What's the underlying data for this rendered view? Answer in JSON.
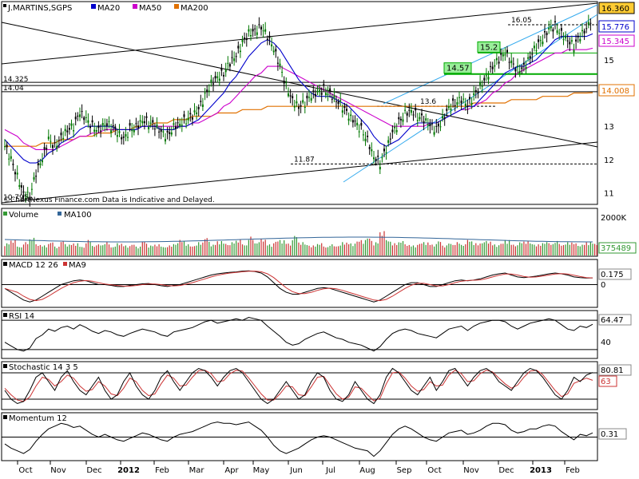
{
  "chart_data": {
    "type": "line",
    "symbol": "J.MARTINS,SGPS",
    "watermark": "©ChartNexus Finance.com   Data is Indicative and Delayed.",
    "x_labels": [
      "Oct",
      "Nov",
      "Dec",
      "2012",
      "Feb",
      "Mar",
      "Apr",
      "May",
      "Jun",
      "Jul",
      "Aug",
      "Sep",
      "Oct",
      "Nov",
      "Dec",
      "2013",
      "Feb"
    ],
    "price_panel": {
      "series_legend": [
        "MA20",
        "MA50",
        "MA200"
      ],
      "legend_colors": [
        "#0000cc",
        "#cc00cc",
        "#e07000"
      ],
      "y_ticks": [
        "16",
        "15",
        "14",
        "13",
        "12",
        "11"
      ],
      "ylim": [
        10.8,
        16.6
      ],
      "last_values": [
        {
          "label": "16.360",
          "value": 16.36,
          "color": "#000000",
          "bg": "#ffcc33"
        },
        {
          "label": "15.776",
          "value": 15.776,
          "color": "#0000cc",
          "bg": "#ffffff"
        },
        {
          "label": "15.345",
          "value": 15.345,
          "color": "#cc00cc",
          "bg": "#ffffff"
        },
        {
          "label": "14.008",
          "value": 14.008,
          "color": "#e07000",
          "bg": "#ffffff"
        }
      ],
      "level_annotations": [
        {
          "text": "16.05",
          "value": 16.05
        },
        {
          "text": "15.2",
          "value": 15.2,
          "box": true
        },
        {
          "text": "14.57",
          "value": 14.57,
          "box": true
        },
        {
          "text": "14.325",
          "value": 14.32
        },
        {
          "text": "14.04",
          "value": 14.04
        },
        {
          "text": "13.6",
          "value": 13.6
        },
        {
          "text": "11.87",
          "value": 11.87
        },
        {
          "text": "10.795",
          "value": 10.9
        }
      ],
      "price_series": [
        12.4,
        12.0,
        11.5,
        11.0,
        10.9,
        11.6,
        12.0,
        12.6,
        12.4,
        12.7,
        12.9,
        13.0,
        13.4,
        13.2,
        13.0,
        12.9,
        13.1,
        13.0,
        12.8,
        12.6,
        12.9,
        13.0,
        13.2,
        13.1,
        13.0,
        12.8,
        12.7,
        13.0,
        13.1,
        13.2,
        13.3,
        13.5,
        13.9,
        14.3,
        14.5,
        14.6,
        14.9,
        15.1,
        15.5,
        15.8,
        15.9,
        16.0,
        15.7,
        15.3,
        14.8,
        14.2,
        13.8,
        13.6,
        13.7,
        13.9,
        14.0,
        14.1,
        14.0,
        13.8,
        13.6,
        13.3,
        13.1,
        12.9,
        12.6,
        12.1,
        11.9,
        12.3,
        12.8,
        13.1,
        13.4,
        13.5,
        13.3,
        13.2,
        13.0,
        12.9,
        13.2,
        13.6,
        13.7,
        13.8,
        13.6,
        13.9,
        14.2,
        14.5,
        14.8,
        15.0,
        15.2,
        14.9,
        14.7,
        14.8,
        15.1,
        15.4,
        15.6,
        15.9,
        16.0,
        15.8,
        15.6,
        15.4,
        15.7,
        15.9,
        16.36
      ],
      "ma20_series": [
        12.6,
        12.4,
        12.2,
        12.0,
        11.9,
        11.9,
        12.0,
        12.2,
        12.3,
        12.5,
        12.6,
        12.7,
        12.9,
        13.0,
        13.0,
        13.0,
        13.0,
        13.0,
        12.9,
        12.9,
        12.9,
        12.9,
        13.0,
        13.0,
        13.0,
        12.9,
        12.9,
        12.9,
        13.0,
        13.0,
        13.1,
        13.2,
        13.4,
        13.6,
        13.8,
        14.0,
        14.3,
        14.5,
        14.8,
        15.1,
        15.3,
        15.5,
        15.6,
        15.5,
        15.3,
        15.0,
        14.7,
        14.4,
        14.2,
        14.0,
        13.9,
        13.9,
        13.9,
        13.8,
        13.7,
        13.6,
        13.4,
        13.2,
        13.0,
        12.7,
        12.5,
        12.4,
        12.5,
        12.6,
        12.8,
        13.0,
        13.1,
        13.1,
        13.1,
        13.1,
        13.2,
        13.3,
        13.4,
        13.5,
        13.6,
        13.6,
        13.8,
        14.0,
        14.2,
        14.4,
        14.6,
        14.7,
        14.8,
        14.8,
        14.9,
        15.0,
        15.2,
        15.4,
        15.6,
        15.7,
        15.7,
        15.7,
        15.7,
        15.7,
        15.776
      ],
      "ma50_series": [
        12.9,
        12.8,
        12.7,
        12.5,
        12.4,
        12.3,
        12.3,
        12.3,
        12.3,
        12.4,
        12.5,
        12.6,
        12.7,
        12.7,
        12.8,
        12.8,
        12.9,
        12.9,
        12.9,
        12.9,
        12.9,
        12.9,
        13.0,
        13.0,
        13.0,
        13.0,
        13.0,
        13.0,
        13.0,
        13.0,
        13.1,
        13.1,
        13.2,
        13.3,
        13.4,
        13.6,
        13.7,
        13.9,
        14.1,
        14.3,
        14.5,
        14.6,
        14.8,
        14.8,
        14.8,
        14.7,
        14.6,
        14.5,
        14.4,
        14.3,
        14.2,
        14.1,
        14.0,
        13.9,
        13.8,
        13.7,
        13.6,
        13.5,
        13.4,
        13.3,
        13.2,
        13.1,
        13.0,
        13.0,
        13.0,
        13.0,
        13.0,
        13.0,
        13.1,
        13.1,
        13.2,
        13.3,
        13.4,
        13.5,
        13.5,
        13.6,
        13.7,
        13.8,
        14.0,
        14.1,
        14.3,
        14.4,
        14.6,
        14.7,
        14.8,
        14.9,
        15.0,
        15.1,
        15.2,
        15.2,
        15.3,
        15.3,
        15.3,
        15.3,
        15.345
      ],
      "ma200_series": [
        12.4,
        12.4,
        12.4,
        12.4,
        12.4,
        12.4,
        12.5,
        12.5,
        12.5,
        12.6,
        12.6,
        12.6,
        12.7,
        12.7,
        12.7,
        12.8,
        12.8,
        12.8,
        12.9,
        12.9,
        12.9,
        13.0,
        13.0,
        13.0,
        13.1,
        13.1,
        13.1,
        13.2,
        13.2,
        13.2,
        13.3,
        13.3,
        13.3,
        13.3,
        13.4,
        13.4,
        13.4,
        13.4,
        13.5,
        13.5,
        13.5,
        13.5,
        13.6,
        13.6,
        13.6,
        13.6,
        13.6,
        13.6,
        13.6,
        13.6,
        13.6,
        13.6,
        13.6,
        13.6,
        13.6,
        13.6,
        13.6,
        13.6,
        13.6,
        13.6,
        13.6,
        13.6,
        13.6,
        13.6,
        13.6,
        13.6,
        13.6,
        13.6,
        13.6,
        13.6,
        13.6,
        13.6,
        13.6,
        13.6,
        13.6,
        13.7,
        13.7,
        13.7,
        13.7,
        13.7,
        13.7,
        13.8,
        13.8,
        13.8,
        13.8,
        13.8,
        13.9,
        13.9,
        13.9,
        13.9,
        13.9,
        14.0,
        14.0,
        14.0,
        14.008
      ]
    },
    "volume_panel": {
      "series_legend": [
        "Volume",
        "MA100"
      ],
      "legend_colors": [
        "#339933",
        "#336699"
      ],
      "y_ticks": [
        "2000K"
      ],
      "last_value": "375489",
      "values": [
        0.45,
        0.6,
        0.3,
        0.5,
        0.7,
        0.4,
        0.35,
        0.5,
        0.3,
        0.55,
        0.4,
        0.45,
        0.3,
        0.6,
        0.35,
        0.4,
        0.5,
        0.3,
        0.45,
        0.35,
        0.4,
        0.3,
        0.55,
        0.35,
        0.4,
        0.3,
        0.35,
        0.45,
        0.6,
        0.4,
        0.35,
        0.5,
        0.7,
        0.4,
        0.55,
        0.45,
        0.5,
        0.6,
        0.4,
        0.75,
        0.5,
        0.65,
        0.4,
        0.55,
        0.6,
        0.45,
        0.8,
        0.5,
        0.4,
        0.35,
        0.45,
        0.3,
        0.4,
        0.35,
        0.5,
        0.45,
        0.55,
        0.6,
        0.7,
        0.5,
        1.0,
        0.6,
        0.45,
        0.55,
        0.4,
        0.35,
        0.45,
        0.5,
        0.4,
        0.55,
        0.35,
        0.45,
        0.5,
        0.4,
        0.6,
        0.45,
        0.5,
        0.55,
        0.4,
        0.45,
        0.6,
        0.4,
        0.5,
        0.55,
        0.45,
        0.4,
        0.5,
        0.45,
        0.55,
        0.4,
        0.5,
        0.45,
        0.4,
        0.5,
        0.45
      ]
    },
    "macd_panel": {
      "series_legend": [
        "MACD 12 26",
        "MA9"
      ],
      "legend_colors": [
        "#000000",
        "#cc3333"
      ],
      "y_ticks": [
        "0"
      ],
      "last_value": "0.175",
      "values": [
        -0.1,
        -0.2,
        -0.3,
        -0.4,
        -0.45,
        -0.4,
        -0.3,
        -0.2,
        -0.1,
        0.0,
        0.05,
        0.1,
        0.12,
        0.1,
        0.05,
        0.0,
        0.0,
        -0.02,
        -0.05,
        -0.05,
        -0.02,
        0.0,
        0.02,
        0.03,
        0.0,
        -0.03,
        -0.05,
        -0.02,
        0.0,
        0.05,
        0.1,
        0.15,
        0.2,
        0.25,
        0.28,
        0.3,
        0.32,
        0.33,
        0.35,
        0.36,
        0.34,
        0.3,
        0.2,
        0.05,
        -0.1,
        -0.2,
        -0.25,
        -0.25,
        -0.2,
        -0.15,
        -0.1,
        -0.08,
        -0.1,
        -0.15,
        -0.2,
        -0.25,
        -0.3,
        -0.35,
        -0.4,
        -0.45,
        -0.4,
        -0.3,
        -0.2,
        -0.1,
        0.0,
        0.05,
        0.05,
        0.0,
        -0.05,
        -0.05,
        0.0,
        0.05,
        0.1,
        0.12,
        0.1,
        0.12,
        0.15,
        0.2,
        0.25,
        0.28,
        0.3,
        0.25,
        0.2,
        0.18,
        0.2,
        0.22,
        0.25,
        0.28,
        0.3,
        0.28,
        0.25,
        0.2,
        0.18,
        0.17,
        0.175
      ],
      "ylim": [
        -0.55,
        0.55
      ]
    },
    "rsi_panel": {
      "series_legend": [
        "RSI 14"
      ],
      "y_ticks": [
        "40"
      ],
      "last_value": "64.47",
      "values": [
        40,
        35,
        30,
        28,
        32,
        45,
        50,
        58,
        55,
        60,
        62,
        58,
        64,
        60,
        55,
        52,
        56,
        54,
        50,
        48,
        52,
        55,
        58,
        56,
        54,
        50,
        48,
        54,
        56,
        58,
        60,
        64,
        68,
        70,
        66,
        68,
        70,
        72,
        70,
        74,
        72,
        70,
        62,
        55,
        48,
        40,
        36,
        38,
        44,
        48,
        52,
        54,
        50,
        46,
        44,
        40,
        38,
        36,
        32,
        28,
        34,
        44,
        52,
        56,
        58,
        56,
        52,
        50,
        48,
        46,
        52,
        58,
        60,
        62,
        56,
        62,
        66,
        68,
        70,
        70,
        68,
        62,
        58,
        62,
        66,
        68,
        70,
        72,
        70,
        64,
        58,
        56,
        62,
        60,
        64.47
      ],
      "ylim": [
        20,
        80
      ]
    },
    "stoch_panel": {
      "series_legend": [
        "Stochastic 14 3 5"
      ],
      "y_ticks": [
        "63"
      ],
      "last_values": [
        "80.81",
        "63"
      ],
      "values": [
        40,
        20,
        10,
        15,
        40,
        70,
        80,
        60,
        40,
        70,
        85,
        60,
        40,
        30,
        50,
        70,
        40,
        20,
        30,
        60,
        80,
        50,
        30,
        20,
        40,
        70,
        85,
        60,
        40,
        60,
        80,
        90,
        85,
        70,
        50,
        70,
        85,
        90,
        80,
        60,
        40,
        20,
        10,
        20,
        40,
        60,
        40,
        20,
        30,
        60,
        80,
        70,
        40,
        20,
        15,
        30,
        60,
        40,
        20,
        10,
        30,
        70,
        90,
        80,
        60,
        40,
        30,
        50,
        70,
        40,
        60,
        85,
        90,
        70,
        50,
        70,
        85,
        90,
        80,
        60,
        50,
        40,
        60,
        80,
        90,
        85,
        70,
        50,
        30,
        20,
        40,
        70,
        60,
        75,
        80.81
      ],
      "signal": [
        45,
        30,
        18,
        15,
        25,
        50,
        70,
        65,
        50,
        60,
        75,
        68,
        50,
        38,
        42,
        60,
        50,
        32,
        28,
        45,
        68,
        60,
        40,
        28,
        32,
        55,
        75,
        68,
        50,
        52,
        70,
        85,
        86,
        78,
        60,
        62,
        78,
        86,
        84,
        68,
        50,
        32,
        18,
        18,
        32,
        50,
        48,
        30,
        28,
        48,
        70,
        72,
        52,
        32,
        20,
        25,
        48,
        45,
        30,
        16,
        22,
        55,
        80,
        82,
        68,
        50,
        38,
        42,
        60,
        50,
        52,
        75,
        86,
        78,
        60,
        62,
        78,
        86,
        82,
        68,
        55,
        45,
        52,
        70,
        84,
        86,
        76,
        58,
        40,
        26,
        32,
        56,
        62,
        68,
        63
      ],
      "ylim": [
        0,
        100
      ]
    },
    "momentum_panel": {
      "series_legend": [
        "Momentum 12"
      ],
      "last_value": "0.31",
      "values": [
        -0.5,
        -0.8,
        -1.0,
        -1.2,
        -0.9,
        -0.3,
        0.2,
        0.6,
        0.8,
        1.0,
        0.9,
        0.7,
        0.8,
        0.5,
        0.2,
        0.0,
        0.2,
        0.0,
        -0.2,
        -0.3,
        -0.1,
        0.1,
        0.3,
        0.2,
        0.0,
        -0.2,
        -0.3,
        0.0,
        0.2,
        0.3,
        0.4,
        0.6,
        0.8,
        1.0,
        1.1,
        1.0,
        1.0,
        0.9,
        1.0,
        1.1,
        0.8,
        0.5,
        0.0,
        -0.6,
        -1.0,
        -1.2,
        -1.0,
        -0.8,
        -0.5,
        -0.2,
        0.0,
        0.1,
        0.0,
        -0.2,
        -0.4,
        -0.6,
        -0.8,
        -0.9,
        -1.0,
        -1.4,
        -1.0,
        -0.4,
        0.2,
        0.6,
        0.8,
        0.6,
        0.3,
        0.0,
        -0.2,
        -0.3,
        0.0,
        0.3,
        0.4,
        0.5,
        0.2,
        0.3,
        0.5,
        0.8,
        1.0,
        1.0,
        0.9,
        0.5,
        0.3,
        0.4,
        0.6,
        0.6,
        0.8,
        0.9,
        0.8,
        0.4,
        0.1,
        -0.2,
        0.2,
        0.1,
        0.31
      ],
      "ylim": [
        -1.6,
        1.6
      ]
    }
  }
}
